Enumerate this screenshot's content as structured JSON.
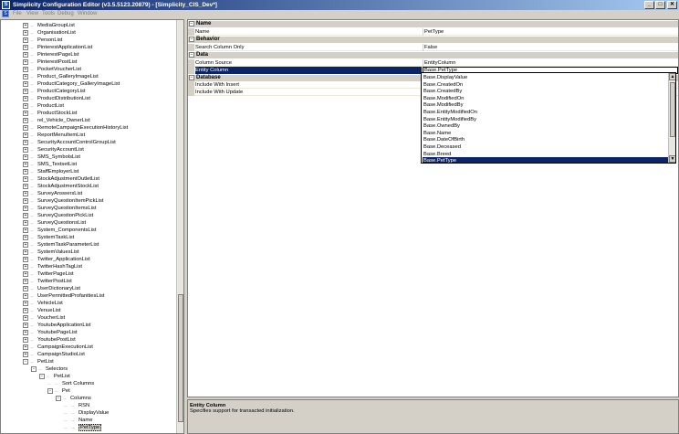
{
  "window": {
    "title": "Simplicity Configuration Editor (v3.5.5123.20879) - [Simplicity_CIS_Dev*]",
    "app_icon": "S",
    "min": "_",
    "max": "□",
    "close": "✕"
  },
  "menu": [
    "File",
    "View",
    "Tools",
    "Debug",
    "Window"
  ],
  "tree": [
    {
      "label": "MediaGroupList",
      "level": 1,
      "exp": "+"
    },
    {
      "label": "OrganisationList",
      "level": 1,
      "exp": "+"
    },
    {
      "label": "PersonList",
      "level": 1,
      "exp": "+"
    },
    {
      "label": "PinterestApplicationList",
      "level": 1,
      "exp": "+"
    },
    {
      "label": "PinterestPageList",
      "level": 1,
      "exp": "+"
    },
    {
      "label": "PinterestPostList",
      "level": 1,
      "exp": "+"
    },
    {
      "label": "PocketVoucherList",
      "level": 1,
      "exp": "+"
    },
    {
      "label": "Product_GalleryImageList",
      "level": 1,
      "exp": "+"
    },
    {
      "label": "ProductCategory_GalleryImageList",
      "level": 1,
      "exp": "+"
    },
    {
      "label": "ProductCategoryList",
      "level": 1,
      "exp": "+"
    },
    {
      "label": "ProductDistributionList",
      "level": 1,
      "exp": "+"
    },
    {
      "label": "ProductList",
      "level": 1,
      "exp": "+"
    },
    {
      "label": "ProductStockList",
      "level": 1,
      "exp": "+"
    },
    {
      "label": "rel_Vehicle_OwnerList",
      "level": 1,
      "exp": "+"
    },
    {
      "label": "RemoteCampaignExecutionHistoryList",
      "level": 1,
      "exp": "+"
    },
    {
      "label": "ReportMenuItemList",
      "level": 1,
      "exp": "+"
    },
    {
      "label": "SecurityAccountControlGroupList",
      "level": 1,
      "exp": "+"
    },
    {
      "label": "SecurityAccountList",
      "level": 1,
      "exp": "+"
    },
    {
      "label": "SMS_SymbolsList",
      "level": 1,
      "exp": "+"
    },
    {
      "label": "SMS_TextsetList",
      "level": 1,
      "exp": "+"
    },
    {
      "label": "StaffEmployerList",
      "level": 1,
      "exp": "+"
    },
    {
      "label": "StockAdjustmentOutletList",
      "level": 1,
      "exp": "+"
    },
    {
      "label": "StockAdjustmentStockList",
      "level": 1,
      "exp": "+"
    },
    {
      "label": "SurveyAnswersList",
      "level": 1,
      "exp": "+"
    },
    {
      "label": "SurveyQuestionItemPickList",
      "level": 1,
      "exp": "+"
    },
    {
      "label": "SurveyQuestionItemsList",
      "level": 1,
      "exp": "+"
    },
    {
      "label": "SurveyQuestionPickList",
      "level": 1,
      "exp": "+"
    },
    {
      "label": "SurveyQuestionsList",
      "level": 1,
      "exp": "+"
    },
    {
      "label": "System_ComponentsList",
      "level": 1,
      "exp": "+"
    },
    {
      "label": "SystemTaskList",
      "level": 1,
      "exp": "+"
    },
    {
      "label": "SystemTaskParameterList",
      "level": 1,
      "exp": "+"
    },
    {
      "label": "SystemValuesList",
      "level": 1,
      "exp": "+"
    },
    {
      "label": "Twitter_ApplicationList",
      "level": 1,
      "exp": "+"
    },
    {
      "label": "TwitterHashTagList",
      "level": 1,
      "exp": "+"
    },
    {
      "label": "TwitterPageList",
      "level": 1,
      "exp": "+"
    },
    {
      "label": "TwitterPostList",
      "level": 1,
      "exp": "+"
    },
    {
      "label": "UserDictionaryList",
      "level": 1,
      "exp": "+"
    },
    {
      "label": "UserPermittedProfanitiesList",
      "level": 1,
      "exp": "+"
    },
    {
      "label": "VehicleList",
      "level": 1,
      "exp": "+"
    },
    {
      "label": "VenueList",
      "level": 1,
      "exp": "+"
    },
    {
      "label": "VoucherList",
      "level": 1,
      "exp": "+"
    },
    {
      "label": "YoutubeApplicationList",
      "level": 1,
      "exp": "+"
    },
    {
      "label": "YoutubePageList",
      "level": 1,
      "exp": "+"
    },
    {
      "label": "YoutubePostList",
      "level": 1,
      "exp": "+"
    },
    {
      "label": "CampaignExecutionList",
      "level": 1,
      "exp": "+"
    },
    {
      "label": "CampaignStudioList",
      "level": 1,
      "exp": "+"
    },
    {
      "label": "PetList",
      "level": 1,
      "exp": "-"
    },
    {
      "label": "Selectors",
      "level": 2,
      "exp": "-"
    },
    {
      "label": "PetList",
      "level": 3,
      "exp": "-"
    },
    {
      "label": "Sort Columns",
      "level": 4,
      "exp": ""
    },
    {
      "label": "Pet",
      "level": 4,
      "exp": "-"
    },
    {
      "label": "Columns",
      "level": 5,
      "exp": "-"
    },
    {
      "label": "RSN",
      "level": 6,
      "exp": ""
    },
    {
      "label": "DisplayValue",
      "level": 6,
      "exp": ""
    },
    {
      "label": "Name",
      "level": 6,
      "exp": ""
    },
    {
      "label": "PetType",
      "level": 6,
      "exp": "",
      "selected": true
    }
  ],
  "properties": {
    "categories": [
      {
        "label": "Name",
        "exp": "−",
        "rows": [
          {
            "name": "Name",
            "value": "PetType"
          }
        ]
      },
      {
        "label": "Behavior",
        "exp": "−",
        "rows": [
          {
            "name": "Search Column Only",
            "value": "False"
          }
        ]
      },
      {
        "label": "Data",
        "exp": "−",
        "rows": [
          {
            "name": "Column Source",
            "value": "EntityColumn"
          },
          {
            "name": "Entity Column",
            "value": "Base.PetType",
            "selected": true
          }
        ]
      },
      {
        "label": "Database",
        "exp": "−",
        "rows": [
          {
            "name": "Include With Insert",
            "value": ""
          },
          {
            "name": "Include With Update",
            "value": ""
          }
        ]
      }
    ]
  },
  "dropdown": {
    "items": [
      "Base.DisplayValue",
      "Base.CreatedOn",
      "Base.CreatedBy",
      "Base.ModifiedOn",
      "Base.ModifiedBy",
      "Base.EntityModifiedOn",
      "Base.EntityModifiedBy",
      "Base.OwnedBy",
      "Base.Name",
      "Base.DateOfBirth",
      "Base.Deceased",
      "Base.Breed",
      "Base.PetType"
    ],
    "selected_index": 12
  },
  "description": {
    "title": "Entity Column",
    "text": "Specifies support for transacted initialization."
  }
}
